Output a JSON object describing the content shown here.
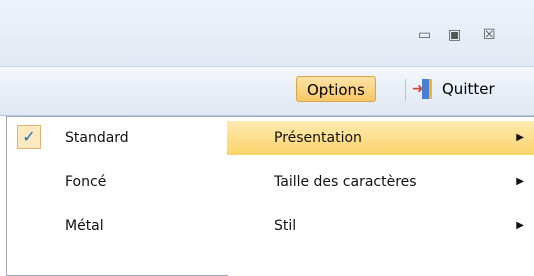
{
  "window": {
    "minimize": "▭",
    "maximize": "▣",
    "close": "☒"
  },
  "toolbar": {
    "options_label": "Options",
    "quit_label": "Quitter"
  },
  "submenu": {
    "items": [
      {
        "label": "Standard",
        "checked": true,
        "check": "✓"
      },
      {
        "label": "Foncé",
        "checked": false
      },
      {
        "label": "Métal",
        "checked": false
      }
    ]
  },
  "main_menu": {
    "items": [
      {
        "label": "Présentation",
        "highlighted": true,
        "arrow": "▶"
      },
      {
        "label": "Taille des caractères",
        "highlighted": false,
        "arrow": "▶"
      },
      {
        "label": "Stil",
        "highlighted": false,
        "arrow": "▶"
      }
    ]
  },
  "colors": {
    "highlight": "#fbd36a",
    "check": "#1a73c9"
  }
}
